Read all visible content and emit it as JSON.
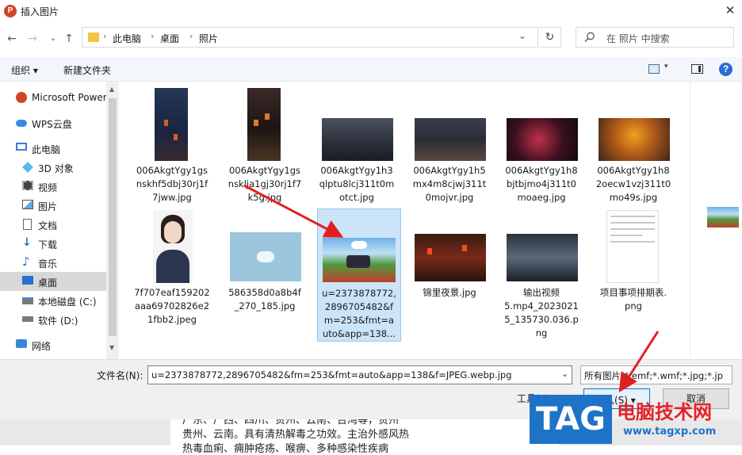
{
  "window": {
    "app_icon": "P",
    "title": "插入图片",
    "close_glyph": "✕"
  },
  "address": {
    "crumbs": [
      "此电脑",
      "桌面",
      "照片"
    ],
    "separator": "›",
    "search_placeholder": "在 照片 中搜索"
  },
  "toolbar": {
    "organize_label": "组织 ▾",
    "new_folder_label": "新建文件夹",
    "help_glyph": "?"
  },
  "sidebar": {
    "items": [
      {
        "label": "Microsoft Power",
        "icon": "powerpoint-icon"
      },
      {
        "label": "WPS云盘",
        "icon": "cloud-icon"
      },
      {
        "label": "此电脑",
        "icon": "computer-icon"
      },
      {
        "label": "3D 对象",
        "icon": "cube-icon"
      },
      {
        "label": "视频",
        "icon": "video-icon"
      },
      {
        "label": "图片",
        "icon": "picture-icon"
      },
      {
        "label": "文档",
        "icon": "document-icon"
      },
      {
        "label": "下载",
        "icon": "download-icon"
      },
      {
        "label": "音乐",
        "icon": "music-icon"
      },
      {
        "label": "桌面",
        "icon": "desktop-icon",
        "selected": true
      },
      {
        "label": "本地磁盘 (C:)",
        "icon": "drive-icon"
      },
      {
        "label": "软件 (D:)",
        "icon": "drive-icon"
      },
      {
        "label": "网络",
        "icon": "network-icon"
      }
    ]
  },
  "files": [
    {
      "name": "006AkgtYgy1gsnskhf5dbj30rj1f7jww.jpg",
      "lines": [
        "006AkgtYgy1gs",
        "nskhf5dbj30rj1f",
        "7jww.jpg"
      ]
    },
    {
      "name": "006AkgtYgy1gsnsklja1gj30rj1f7k5g.jpg",
      "lines": [
        "006AkgtYgy1gs",
        "nsklja1gj30rj1f7",
        "k5g.jpg"
      ]
    },
    {
      "name": "006AkgtYgy1h3qlptu8lcj311t0motct.jpg",
      "lines": [
        "006AkgtYgy1h3",
        "qlptu8lcj311t0m",
        "otct.jpg"
      ]
    },
    {
      "name": "006AkgtYgy1h5mx4m8cjwj311t0mojvr.jpg",
      "lines": [
        "006AkgtYgy1h5",
        "mx4m8cjwj311t",
        "0mojvr.jpg"
      ]
    },
    {
      "name": "006AkgtYgy1h8bjtbjmo4j311t0moaeg.jpg",
      "lines": [
        "006AkgtYgy1h8",
        "bjtbjmo4j311t0",
        "moaeg.jpg"
      ]
    },
    {
      "name": "006AkgtYgy1h82oecw1vzj311t0mo49s.jpg",
      "lines": [
        "006AkgtYgy1h8",
        "2oecw1vzj311t0",
        "mo49s.jpg"
      ]
    },
    {
      "name": "7f707eaf159202aaa69702826e21fbb2.jpeg",
      "lines": [
        "7f707eaf159202",
        "aaa69702826e2",
        "1fbb2.jpeg"
      ]
    },
    {
      "name": "586358d0a8b4f_270_185.jpg",
      "lines": [
        "586358d0a8b4f",
        "_270_185.jpg"
      ]
    },
    {
      "name": "u=2373878772,2896705482&fm=253&fmt=auto&app=138...",
      "lines": [
        "u=2373878772,",
        "2896705482&f",
        "m=253&fmt=a",
        "uto&app=138..."
      ],
      "selected": true
    },
    {
      "name": "锦里夜景.jpg",
      "lines": [
        "锦里夜景.jpg"
      ]
    },
    {
      "name": "输出视频5.mp4_20230215_135730.036.png",
      "lines": [
        "输出视频",
        "5.mp4_2023021",
        "5_135730.036.p",
        "ng"
      ]
    },
    {
      "name": "项目事项排期表.png",
      "lines": [
        "项目事项排期表.",
        "png"
      ]
    }
  ],
  "bottom": {
    "filename_label": "文件名(N):",
    "filename_value": "u=2373878772,2896705482&fm=253&fmt=auto&app=138&f=JPEG.webp.jpg",
    "filetype_value": "所有图片(*.emf;*.wmf;*.jpg;*.jp",
    "tools_label": "工具(L) ▾",
    "insert_label": "插入(S) ▾",
    "cancel_label": "取消"
  },
  "background_doc": {
    "lines": [
      "广东、广西、四川、贵州、云南、台湾等，贵州",
      "贵州、云南。具有清热解毒之功效。主治外感风热",
      "热毒血痢、痈肿疮疡、喉痹、多种感染性疾病"
    ]
  },
  "watermark": {
    "logo": "TAG",
    "title": "电脑技术网",
    "url": "www.tagxp.com"
  },
  "colors": {
    "selection": "#cce4f7",
    "accent": "#0078d7",
    "arrow": "#e02020",
    "watermark_blue": "#1e73c9",
    "watermark_red": "#e62129"
  }
}
